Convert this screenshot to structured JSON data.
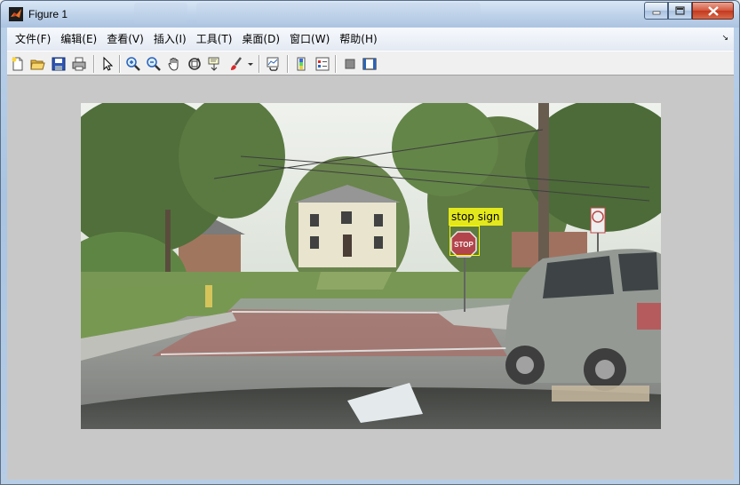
{
  "window": {
    "title": "Figure 1",
    "controls": {
      "minimize": "minimize",
      "maximize": "maximize",
      "close": "close"
    }
  },
  "menu": {
    "items": [
      {
        "label": "文件(F)"
      },
      {
        "label": "编辑(E)"
      },
      {
        "label": "查看(V)"
      },
      {
        "label": "插入(I)"
      },
      {
        "label": "工具(T)"
      },
      {
        "label": "桌面(D)"
      },
      {
        "label": "窗口(W)"
      },
      {
        "label": "帮助(H)"
      }
    ],
    "dock_arrow": "↘"
  },
  "toolbar": {
    "buttons": [
      "new-figure-icon",
      "open-file-icon",
      "save-icon",
      "print-icon",
      "edit-plot-arrow-icon",
      "zoom-in-icon",
      "zoom-out-icon",
      "pan-hand-icon",
      "rotate-3d-icon",
      "data-cursor-icon",
      "brush-icon",
      "brush-dropdown-icon",
      "link-plot-icon",
      "colorbar-icon",
      "legend-icon",
      "hide-plot-tools-icon",
      "show-plot-tools-icon"
    ]
  },
  "figure": {
    "image_description": "street scene photo through car windshield",
    "detection": {
      "label": "stop sign",
      "box_color": "#ffff00",
      "label_bg": "#e3e81c"
    },
    "sign_text": "STOP"
  }
}
